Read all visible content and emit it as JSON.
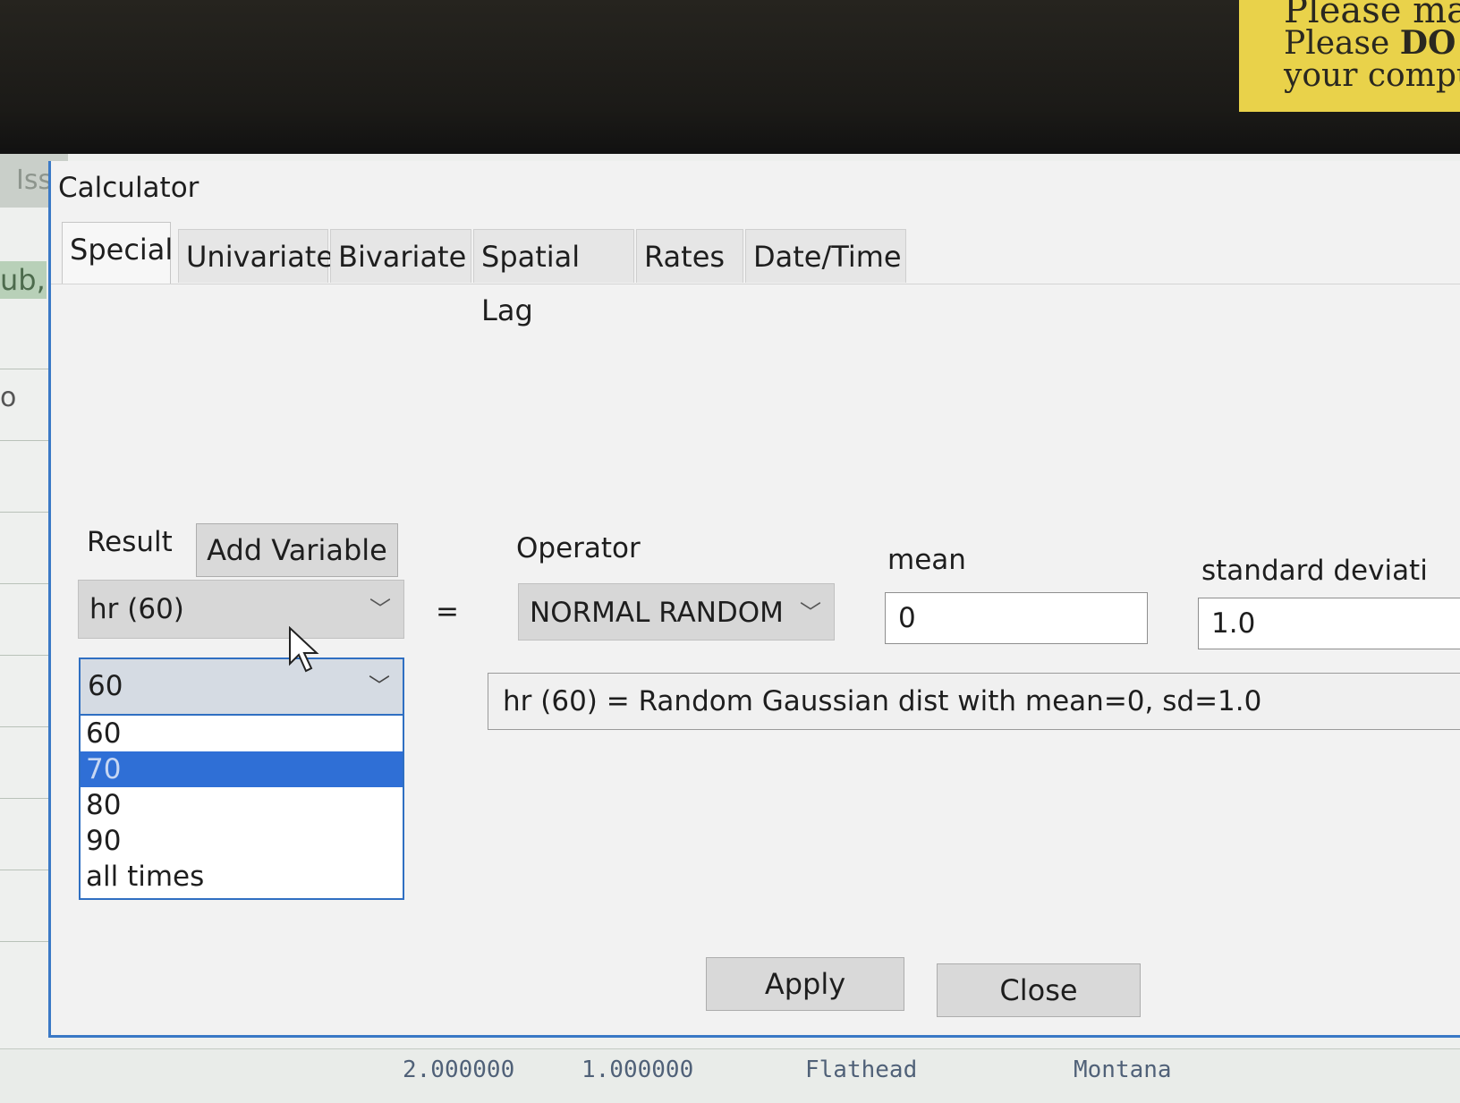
{
  "sticky_note": {
    "line1": "Please ma",
    "line2_prefix": "Please ",
    "line2_bold": "DO N",
    "line3": "your compute"
  },
  "background_app": {
    "tab_stub": "Iss",
    "side_stub": "ub,",
    "side_stub2": "o",
    "bottom_values": [
      "2.000000",
      "1.000000",
      "Flathead",
      "Montana"
    ]
  },
  "dialog": {
    "title": "Calculator",
    "tabs": [
      {
        "label": "Special",
        "active": true
      },
      {
        "label": "Univariate",
        "active": false
      },
      {
        "label": "Bivariate",
        "active": false
      },
      {
        "label": "Spatial Lag",
        "active": false
      },
      {
        "label": "Rates",
        "active": false
      },
      {
        "label": "Date/Time",
        "active": false
      }
    ],
    "result_label": "Result",
    "add_variable_label": "Add Variable",
    "result_value": "hr (60)",
    "equals": "=",
    "time_select": {
      "value": "60",
      "options": [
        "60",
        "70",
        "80",
        "90",
        "all times"
      ],
      "highlighted": "70"
    },
    "operator_label": "Operator",
    "operator_value": "NORMAL RANDOM",
    "mean_label": "mean",
    "mean_value": "0",
    "sd_label": "standard deviati",
    "sd_value": "1.0",
    "expression": "hr (60) = Random Gaussian dist with mean=0, sd=1.0",
    "apply_label": "Apply",
    "close_label": "Close"
  }
}
